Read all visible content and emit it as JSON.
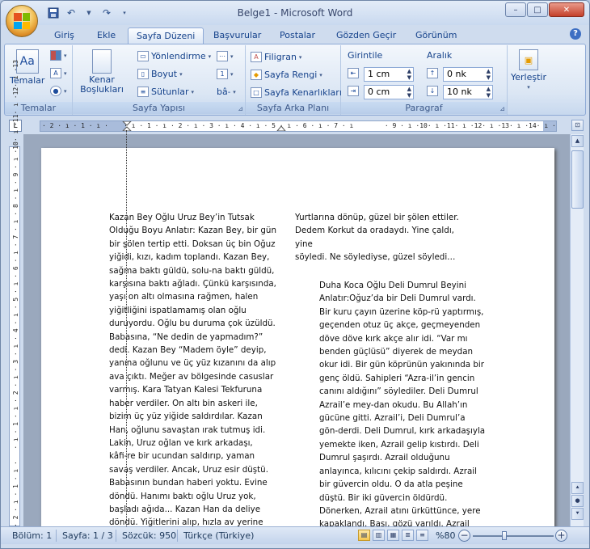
{
  "window": {
    "title": "Belge1 - Microsoft Word",
    "minimize": "–",
    "maximize": "□",
    "close": "✕"
  },
  "quick_access": {
    "save_icon": "save-icon",
    "undo_icon": "undo-icon",
    "redo_icon": "redo-icon",
    "customize_icon": "customize-icon"
  },
  "ribbon_tabs": [
    {
      "label": "Giriş"
    },
    {
      "label": "Ekle"
    },
    {
      "label": "Sayfa Düzeni",
      "active": true
    },
    {
      "label": "Başvurular"
    },
    {
      "label": "Postalar"
    },
    {
      "label": "Gözden Geçir"
    },
    {
      "label": "Görünüm"
    }
  ],
  "groups": {
    "temalar": {
      "label": "Temalar",
      "temalar_button": "Temalar",
      "theme_colors_icon": "theme-colors-icon",
      "theme_fonts_label": "A",
      "theme_effects_icon": "theme-effects-icon"
    },
    "sayfa_yapisi": {
      "label": "Sayfa Yapısı",
      "kenar": "Kenar\nBoşlukları",
      "yonlendirme": "Yönlendirme",
      "boyut": "Boyut",
      "sutunlar": "Sütunlar",
      "sayfa_sonu_icon": "breaks-icon",
      "satir_no_icon": "line-numbers-icon",
      "heceleme": "bâ˗"
    },
    "sayfa_arka_plani": {
      "label": "Sayfa Arka Planı",
      "filigran": "Filigran",
      "sayfa_rengi": "Sayfa Rengi",
      "sayfa_kenarliklari": "Sayfa Kenarlıkları"
    },
    "paragraf": {
      "label": "Paragraf",
      "girintile": "Girintile",
      "aralik": "Aralık",
      "indent_left": "1 cm",
      "indent_right": "0 cm",
      "spacing_before": "0 nk",
      "spacing_after": "10 nk"
    },
    "yerlestir": {
      "label": "Yerleştir"
    }
  },
  "ruler": {
    "horizontal": "· 2 · ı · 1 · ı ·    · ı · 1 · ı · 2 · ı · 3 · ı · 4 · ı · 5 · ı · 6 · ı · 7 · ı        · 9 · ı ·10· ı ·11· ı ·12· ı ·13· ı ·14· ı ·15· ı ·16· ı ·17· ı ·18·",
    "vertical": "· 2 · ı · 1 · ı ·   · ı · 1 · ı · 2 · ı · 3 · ı · 4 · ı · 5 · ı · 6 · ı · 7 · ı · 8 · ı · 9 · ı ·10· ı ·11· ı ·12· ı ·13"
  },
  "document": {
    "col1": [
      "Kazan Bey Oğlu Uruz Bey’in Tutsak",
      "Olduğu Boyu Anlatır: Kazan Bey, bir gün",
      "bir şölen tertip etti. Doksan üç bin Oğuz",
      "yiğidi, kızı, kadım toplandı. Kazan Bey,",
      "sağma baktı güldü, solu-na baktı güldü,",
      "karşısına baktı ağladı. Çünkü karşısında,",
      "yaşı on altı olmasına rağmen, halen",
      "yiğitliğini ispatlamamış olan oğlu",
      "duruyordu. Oğlu bu duruma çok üzüldü.",
      "Babasına, “Ne dedin de yapmadım?”",
      "dedi. Kazan Bey “Madem öyle” deyip,",
      "yanına oğlunu ve üç yüz kızanını da alıp",
      "ava çıktı. Meğer av bölgesinde casuslar",
      "varmış. Kara Tatyan Kalesi Tekfuruna",
      "haber verdiler. On altı bin askeri ile,",
      "bizim üç yüz yiğide saldırdılar. Kazan",
      "Han, oğlunu savaştan ırak tutmuş idi.",
      "Lakin, Uruz oğlan ve kırk arkadaşı,",
      "kâfi-re bir ucundan saldırıp, yaman",
      "savaş verdiler. Ancak, Uruz esir düştü.",
      "Babasının bundan haberi yoktu. Evine",
      "döndü. Hanımı baktı oğlu Uruz yok,",
      "başladı ağıda... Kazan Han da deliye",
      "döndü. Yiğitlerini alıp, hızla av yerine"
    ],
    "col2a": [
      "Yurtlarına dönüp, güzel bir şölen ettiler.",
      "Dedem Korkut da oradaydı. Yine çaldı, yine",
      "söyledi. Ne söylediyse, güzel söyledi…"
    ],
    "col2b": [
      "Duha Koca Oğlu Deli Dumrul Beyini",
      "Anlatır:Oğuz’da bir Deli Dumrul vardı.",
      "Bir kuru çayın üzerine köp-rü yaptırmış,",
      "geçenden otuz üç akçe, geçmeyenden",
      "döve döve kırk akçe alır idi. “Var mı",
      "benden güçlüsü” diyerek de meydan",
      "okur idi. Bir gün köprünün yakınında bir",
      "genç öldü. Sahipleri “Azra-il’in gencin",
      "canını aldığını” söylediler. Deli Dumrul",
      "Azrail’e mey-dan okudu. Bu Allah’ın",
      "gücüne gitti. Azrail’i, Deli Dumrul’a",
      "gön-derdi. Deli Dumrul, kırk arkadaşıyla",
      "yemekte iken, Azrail gelip kıstırdı. Deli",
      "Dumrul şaşırdı. Azrail olduğunu",
      "anlayınca, kılıcını çekip saldırdı. Azrail",
      "bir güvercin oldu. O da atla peşine",
      "düştü. Bir iki güvercin öldürdü.",
      "Dönerken, Azrail atını ürküttünce, yere",
      "kapaklandı. Başı, gözü yarıldı. Azrail"
    ]
  },
  "status": {
    "bolum": "Bölüm: 1",
    "sayfa": "Sayfa: 1 / 3",
    "sozcuk": "Sözcük: 950",
    "dil": "Türkçe (Türkiye)",
    "zoom": "%80"
  },
  "colors": {
    "accent": "#15428b",
    "ribbon_bg": "#dbe6f4",
    "doc_bg": "#9aa8bd"
  }
}
